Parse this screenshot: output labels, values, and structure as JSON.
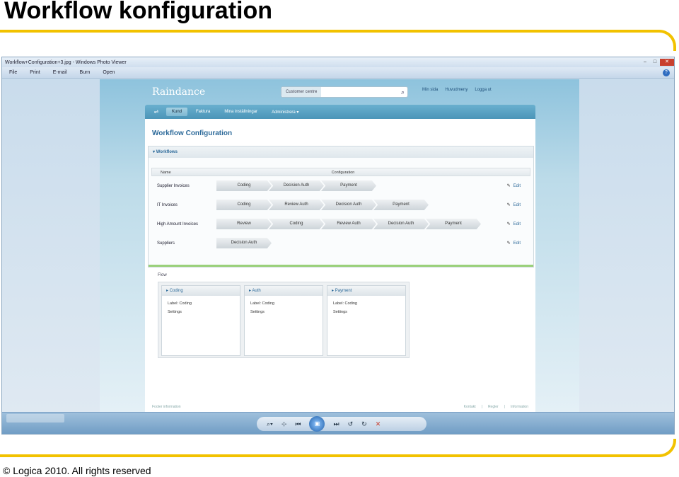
{
  "slide": {
    "title": "Workflow konfiguration",
    "footer": "© Logica 2010. All rights reserved"
  },
  "viewer": {
    "title": "Workflow+Configuration+3.jpg - Windows Photo Viewer",
    "menu": [
      "File",
      "Print",
      "E-mail",
      "Burn",
      "Open"
    ],
    "help": "?",
    "window_controls": [
      "–",
      "□",
      "✕"
    ],
    "controls": [
      "⌕▾",
      "⊹",
      "⏮",
      "▣",
      "⏭",
      "↺",
      "↻",
      "✕"
    ]
  },
  "app": {
    "logo": "Raindance",
    "search_label": "Customer centre",
    "top_links": [
      "Min sida",
      "Huvudmeny",
      "Logga ut"
    ],
    "nav_tabs": [
      "Kund",
      "Faktura",
      "Mina inställningar",
      "Administrera ▾"
    ],
    "page_title": "Workflow Configuration",
    "workflows_header": "Workflows",
    "columns": {
      "name": "Name",
      "configuration": "Configuration"
    },
    "workflows": [
      {
        "name": "Supplier Invoices",
        "steps": [
          "Coding",
          "Decision Auth",
          "Payment"
        ],
        "edit": "Edit"
      },
      {
        "name": "IT Invoices",
        "steps": [
          "Coding",
          "Review Auth",
          "Decision Auth",
          "Payment"
        ],
        "edit": "Edit"
      },
      {
        "name": "High Amount Invoices",
        "steps": [
          "Review",
          "Coding",
          "Review Auth",
          "Decision Auth",
          "Payment"
        ],
        "edit": "Edit"
      },
      {
        "name": "Suppliers",
        "steps": [
          "Decision Auth"
        ],
        "edit": "Edit"
      }
    ],
    "flow_label": "Flow",
    "flow_cards": [
      {
        "title": "Coding",
        "label": "Label: Coding",
        "settings": "Settings"
      },
      {
        "title": "Auth",
        "label": "Label: Coding",
        "settings": "Settings"
      },
      {
        "title": "Payment",
        "label": "Label: Coding",
        "settings": "Settings"
      }
    ],
    "footer_info": "Footer information",
    "footer_links": [
      "Kontakt",
      "|",
      "Regler",
      "|",
      "Information"
    ]
  }
}
